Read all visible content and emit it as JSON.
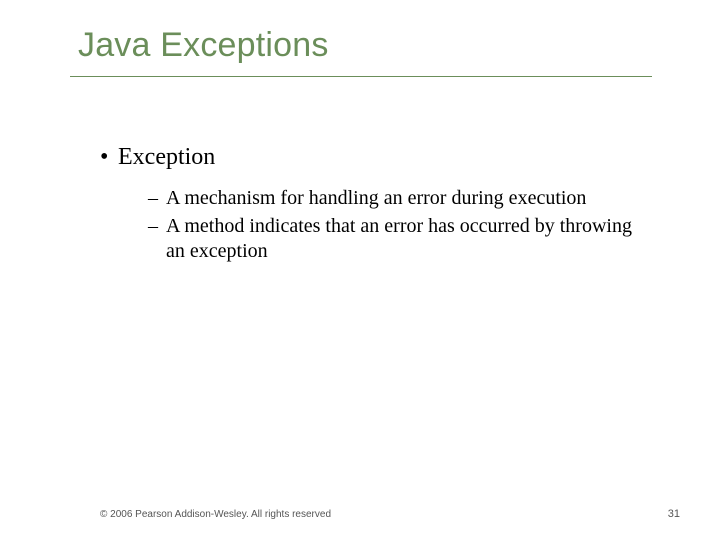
{
  "title": "Java Exceptions",
  "bullets": [
    {
      "text": "Exception",
      "subs": [
        "A mechanism for handling an error during execution",
        "A method indicates that an error has occurred by throwing an exception"
      ]
    }
  ],
  "footer": {
    "copyright": "© 2006 Pearson Addison-Wesley. All rights reserved",
    "page": "31"
  }
}
